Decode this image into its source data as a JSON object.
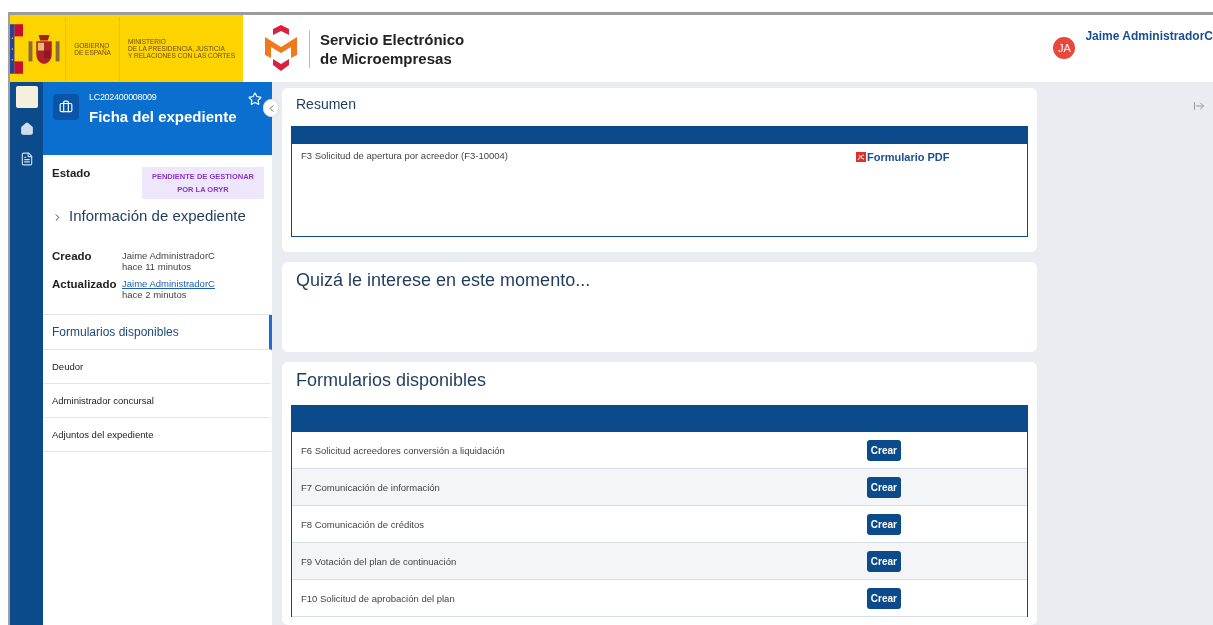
{
  "header": {
    "government": [
      "GOBIERNO",
      "DE ESPAÑA"
    ],
    "ministry": [
      "MINISTERIO",
      "DE LA PRESIDENCIA, JUSTICIA",
      "Y RELACIONES CON LAS CORTES"
    ],
    "service": [
      "Servicio Electrónico",
      "de Microempresas"
    ],
    "user": {
      "initials": "JA",
      "name": "Jaime AdministradorC"
    }
  },
  "sidebar": {
    "case_number": "LC202400008009",
    "title": "Ficha del expediente",
    "starred": false,
    "status_label": "Estado",
    "status": "PENDIENTE DE GESTIONAR POR LA ORYR",
    "section_title": "Información de expediente",
    "expanded": false,
    "meta": [
      {
        "label": "Creado",
        "user": "Jaime AdministradorC",
        "kind": "text",
        "time": "hace 11 minutos"
      },
      {
        "label": "Actualizado",
        "user": "Jaime AdministradorC",
        "kind": "link",
        "time": "hace 2 minutos"
      }
    ],
    "nav": [
      {
        "label": "Formularios disponibles",
        "selected": true
      },
      {
        "label": "Deudor",
        "selected": false
      },
      {
        "label": "Administrador concursal",
        "selected": false
      },
      {
        "label": "Adjuntos del expediente",
        "selected": false
      }
    ]
  },
  "summary": {
    "title": "Resumen",
    "rows": [
      {
        "form": "F3 Solicitud de apertura por acreedor (F3-10004)",
        "document": "Formulario PDF"
      }
    ]
  },
  "suggestions": {
    "title": "Quizá le interese en este momento..."
  },
  "forms": {
    "title": "Formularios disponibles",
    "rows": [
      {
        "name": "F6 Solicitud acreedores conversión a liquidación",
        "action": "Crear"
      },
      {
        "name": "F7 Comunicación de información",
        "action": "Crear"
      },
      {
        "name": "F8 Comunicación de créditos",
        "action": "Crear"
      },
      {
        "name": "F9 Votación del plan de continuación",
        "action": "Crear"
      },
      {
        "name": "F10 Solicitud de aprobación del plan",
        "action": "Crear"
      }
    ]
  }
}
